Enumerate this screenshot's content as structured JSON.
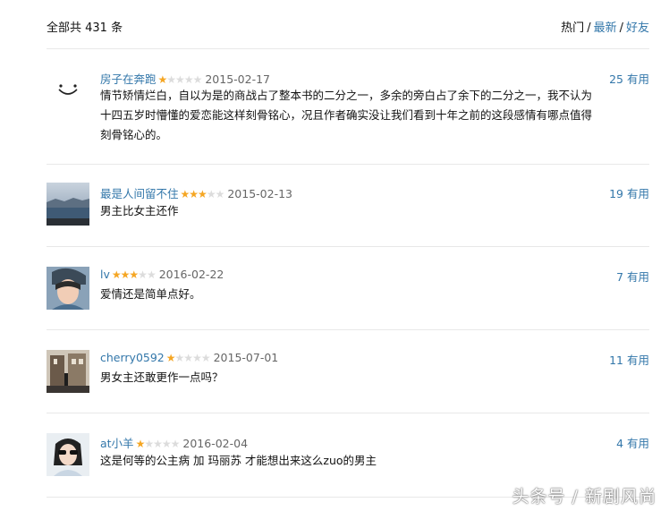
{
  "header": {
    "total": "全部共 431 条",
    "sort": {
      "hot": "热门",
      "sep1": "/",
      "latest": "最新",
      "sep2": "/",
      "friends": "好友"
    }
  },
  "reviews": [
    {
      "user": "房子在奔跑",
      "rating": 1,
      "date": "2015-02-17",
      "useful": "25 有用",
      "text": "情节矫情烂白，自以为是的商战占了整本书的二分之一，多余的旁白占了余下的二分之一，我不认为十四五岁时懵懂的爱恋能这样刻骨铭心，况且作者确实没让我们看到十年之前的这段感情有哪点值得刻骨铭心的。",
      "avatar": "smiley-avatar"
    },
    {
      "user": "最是人间留不住",
      "rating": 3,
      "date": "2015-02-13",
      "useful": "19 有用",
      "text": "男主比女主还作",
      "avatar": "lake-landscape-avatar"
    },
    {
      "user": "lv",
      "rating": 3,
      "date": "2016-02-22",
      "useful": "7 有用",
      "text": "爱情还是简单点好。",
      "avatar": "girl-portrait-avatar"
    },
    {
      "user": "cherry0592",
      "rating": 1,
      "date": "2015-07-01",
      "useful": "11 有用",
      "text": "男女主还敢更作一点吗？",
      "avatar": "street-scene-avatar"
    },
    {
      "user": "at小羊",
      "rating": 1,
      "date": "2016-02-04",
      "useful": "4 有用",
      "text": "这是何等的公主病 加 玛丽苏 才能想出来这么zuo的男主",
      "avatar": "sunglasses-girl-avatar"
    }
  ],
  "watermark": "头条号 / 新剧风尚",
  "colors": {
    "link": "#3377aa",
    "star_on": "#f5a623",
    "star_off": "#dcdcdc",
    "divider": "#e8e8e8"
  }
}
